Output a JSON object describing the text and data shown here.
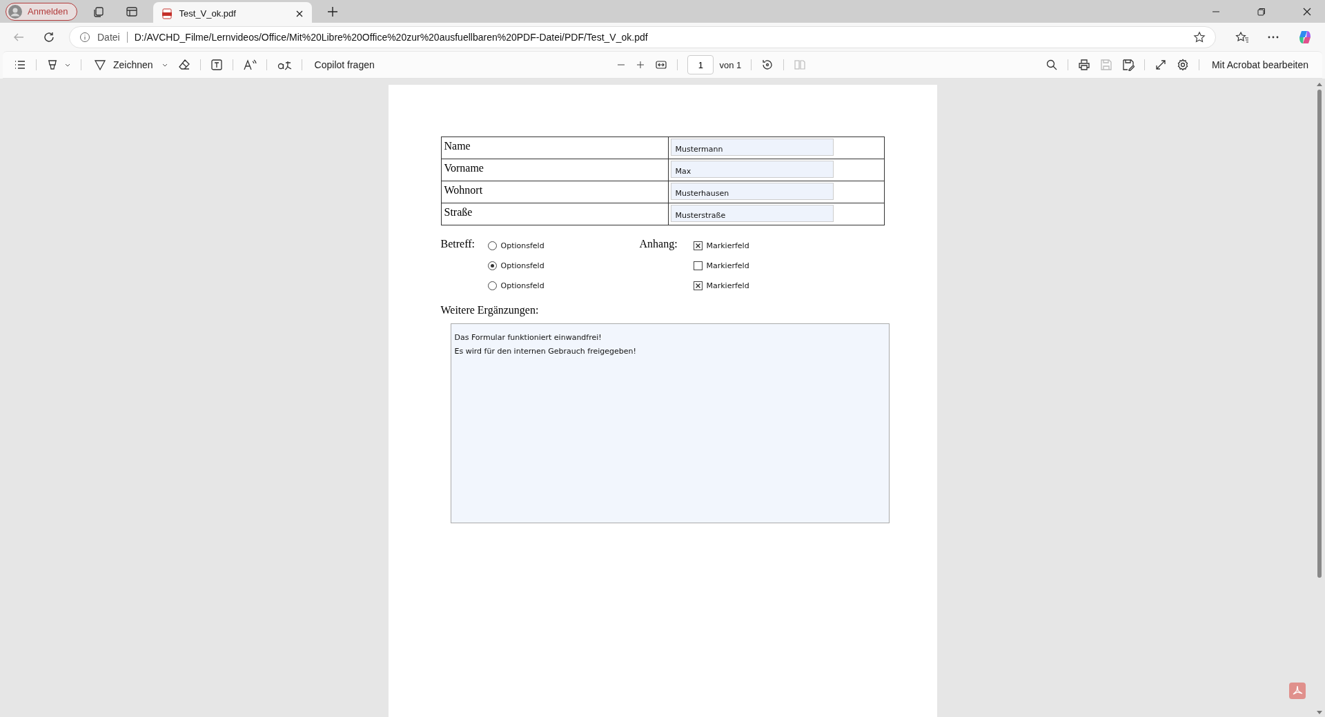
{
  "browser": {
    "profile_button": "Anmelden",
    "tabs": [
      {
        "title": "Test_V_ok.pdf",
        "selected": true
      }
    ],
    "address": {
      "scheme_label": "Datei",
      "url": "D:/AVCHD_Filme/Lernvideos/Office/Mit%20Libre%20Office%20zur%20ausfuellbaren%20PDF-Datei/PDF/Test_V_ok.pdf"
    }
  },
  "pdf_toolbar": {
    "draw_label": "Zeichnen",
    "copilot_label": "Copilot fragen",
    "page_number": "1",
    "page_total": "von 1",
    "acrobat_label": "Mit Acrobat bearbeiten"
  },
  "form": {
    "rows": [
      {
        "label": "Name",
        "value": "Mustermann"
      },
      {
        "label": "Vorname",
        "value": "Max"
      },
      {
        "label": "Wohnort",
        "value": "Musterhausen"
      },
      {
        "label": "Straße",
        "value": "Musterstraße"
      }
    ],
    "subject_label": "Betreff:",
    "options": [
      {
        "label": "Optionsfeld",
        "selected": false
      },
      {
        "label": "Optionsfeld",
        "selected": true
      },
      {
        "label": "Optionsfeld",
        "selected": false
      }
    ],
    "attachment_label": "Anhang:",
    "checkboxes": [
      {
        "label": "Markierfeld",
        "checked": true
      },
      {
        "label": "Markierfeld",
        "checked": false
      },
      {
        "label": "Markierfeld",
        "checked": true
      }
    ],
    "notes_label": "Weitere Ergänzungen:",
    "notes_lines": [
      "Das Formular funktioniert einwandfrei!",
      "Es wird für den internen Gebrauch freigegeben!"
    ]
  }
}
